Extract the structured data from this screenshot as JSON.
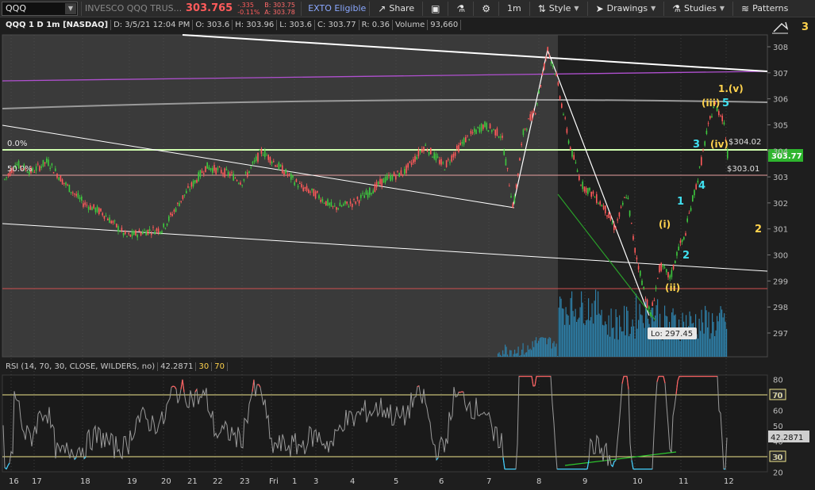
{
  "toolbar": {
    "symbol": "QQQ",
    "description": "INVESCO QQQ TRUS...",
    "last_price": "303.765",
    "net_change": "-.335",
    "pct_change": "-0.11%",
    "bid": "B: 303.75",
    "ask": "A: 303.78",
    "exto": "EXTO Eligible",
    "share_label": "Share",
    "timeframe_label": "1m",
    "style_label": "Style",
    "drawings_label": "Drawings",
    "studies_label": "Studies",
    "patterns_label": "Patterns"
  },
  "price_header": {
    "symbol": "QQQ 1 D 1m [NASDAQ]",
    "date": "D: 3/5/21 12:04 PM",
    "open": "O: 303.6",
    "high": "H: 303.96",
    "low": "L: 303.6",
    "close": "C: 303.77",
    "range": "R: 0.36",
    "volume_label": "Volume",
    "volume_value": "93,660"
  },
  "rsi_header": {
    "label": "RSI (14, 70, 30, CLOSE, WILDERS, no)",
    "value": "42.2871",
    "overbought": "30",
    "oversold": "70"
  },
  "chart_data": {
    "type": "candlestick",
    "price_axis": {
      "min": 296.5,
      "max": 308.5,
      "ticks": [
        "308",
        "307",
        "306",
        "305",
        "304",
        "303",
        "302",
        "301",
        "300",
        "299",
        "298",
        "297"
      ]
    },
    "current_price_label": "303.77",
    "fib_labels": {
      "zero": "0.0%",
      "fifty": "50.0%"
    },
    "price_labels": {
      "p1": "$304.02",
      "p2": "$303.01"
    },
    "low_label": "Lo: 297.45",
    "wave_labels": {
      "i": "(i)",
      "ii": "(ii)",
      "iii": "(iii)",
      "iv": "(iv)",
      "v": "1.(v)",
      "w1": "1",
      "w2": "2",
      "w3": "3",
      "w4": "4",
      "w5": "5",
      "right2": "2",
      "right3": "3"
    },
    "rsi_axis": {
      "min": 20,
      "max": 85,
      "ticks": [
        "80",
        "70",
        "60",
        "50",
        "40",
        "30",
        "20"
      ]
    },
    "rsi_current": "42.2871",
    "rsi_levels": {
      "high": "70",
      "low": "30"
    },
    "x_axis_labels": [
      "16",
      "17",
      "18",
      "19",
      "20",
      "21",
      "22",
      "23",
      "Fri",
      "1",
      "3",
      "4",
      "5",
      "6",
      "7",
      "8",
      "9",
      "10",
      "11",
      "12"
    ],
    "colors": {
      "up": "#3ec93e",
      "down": "#ff5a5a",
      "background": "#3a3a3a",
      "background_dark": "#1f1f1f",
      "fib_line": "#d0ffb0",
      "purple": "#b050d0"
    }
  }
}
